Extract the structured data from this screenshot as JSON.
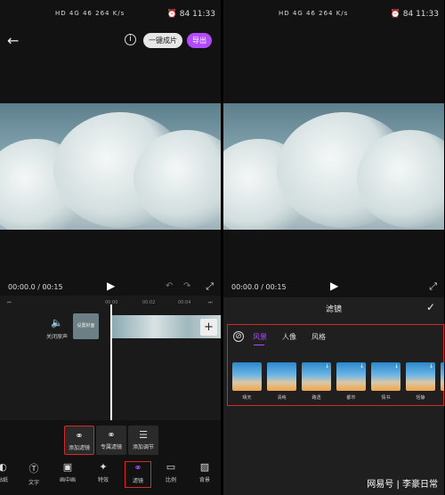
{
  "left": {
    "status_left": "HD 4G 46 264 K/s",
    "clock": "11:33",
    "battery": "84",
    "back_icon": "back-arrow-icon",
    "info": "i",
    "one_key": "一键成片",
    "export": "导出",
    "time_current": "00:00.0",
    "time_sep": "/",
    "time_total": "00:15",
    "ruler": [
      "00:00",
      "00:02",
      "00:04"
    ],
    "mute": "关闭原声",
    "cover": "设置封面",
    "add_clip": "+",
    "subtools": [
      {
        "label": "添加滤镜",
        "icon": "filter-icon"
      },
      {
        "label": "专属滤镜",
        "icon": "ai-filter-icon"
      },
      {
        "label": "添加调节",
        "icon": "adjust-icon"
      }
    ],
    "toolbar": [
      {
        "label": "贴纸",
        "icon": "sticker-icon"
      },
      {
        "label": "文字",
        "icon": "text-icon"
      },
      {
        "label": "画中画",
        "icon": "pip-icon"
      },
      {
        "label": "特效",
        "icon": "effects-icon"
      },
      {
        "label": "滤镜",
        "icon": "filter-icon"
      },
      {
        "label": "比例",
        "icon": "ratio-icon"
      },
      {
        "label": "背景",
        "icon": "background-icon"
      }
    ]
  },
  "right": {
    "clock": "11:33",
    "battery": "84",
    "time_current": "00:00.0",
    "time_total": "00:15",
    "filter_title": "滤镜",
    "tabs": [
      "风景",
      "人像",
      "风格"
    ],
    "active_tab": "风景",
    "filters": [
      "晴天",
      "清纯",
      "路透",
      "都市",
      "情书",
      "恬静",
      ""
    ]
  },
  "watermark": "网易号 | 李豪日常",
  "colors": {
    "accent": "#b24bff",
    "highlight_box": "#d12a2a"
  }
}
